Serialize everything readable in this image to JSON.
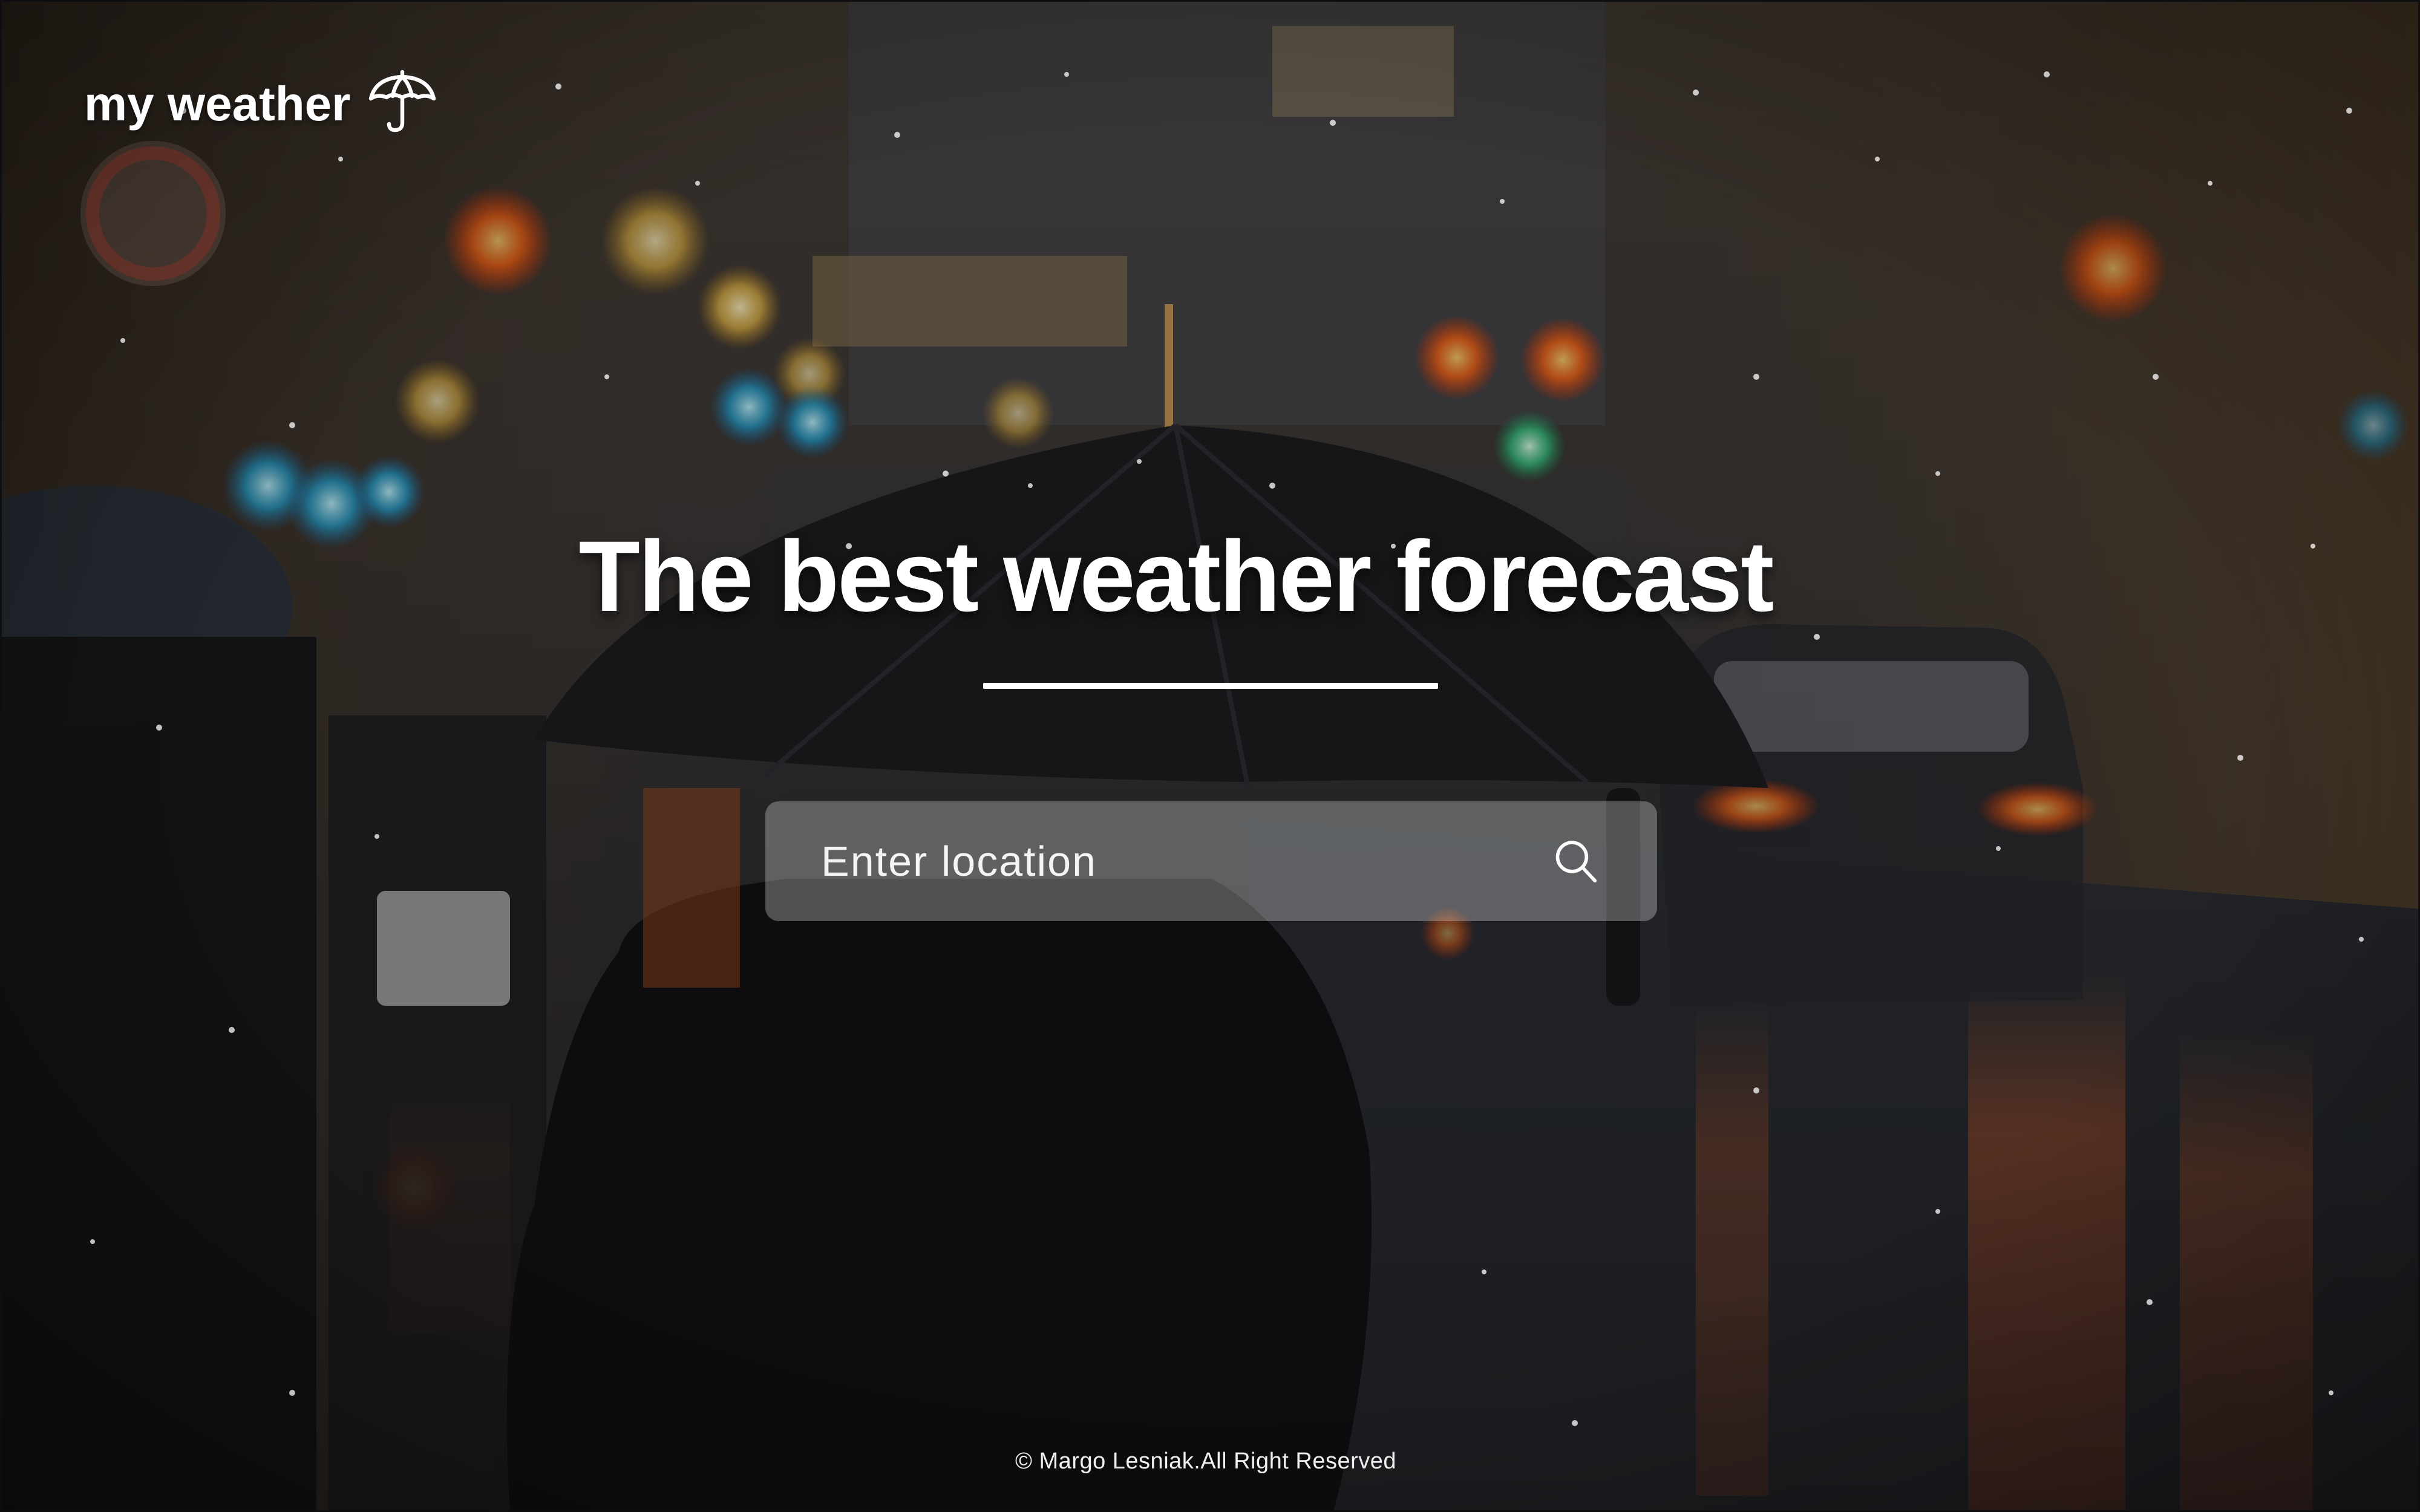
{
  "header": {
    "logo_text": "my weather",
    "logo_icon": "umbrella-icon"
  },
  "hero": {
    "headline": "The best weather forecast"
  },
  "search": {
    "placeholder": "Enter location",
    "value": "",
    "icon": "search-icon"
  },
  "footer": {
    "copyright": "© Margo Lesniak.All Right Reserved"
  },
  "colors": {
    "text": "#ffffff",
    "search_background": "rgba(255,255,255,0.28)"
  }
}
